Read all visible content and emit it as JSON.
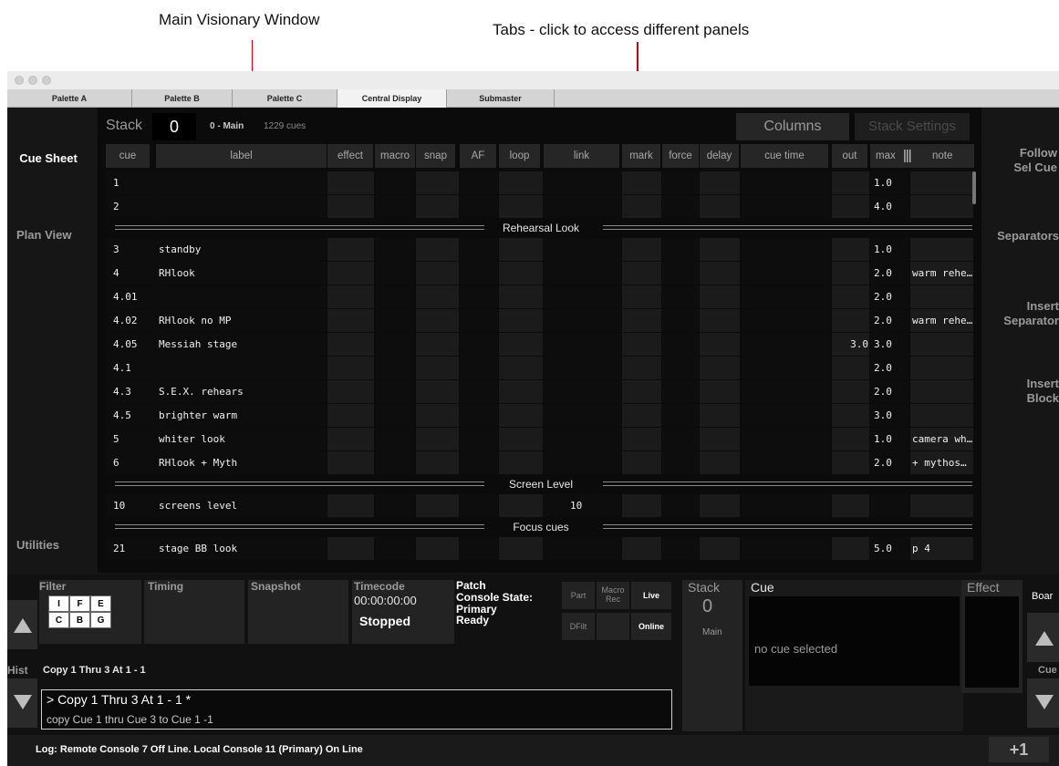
{
  "annotations": {
    "main_window": "Main Visionary Window",
    "tabs": "Tabs - click to access different panels"
  },
  "tabs": [
    "Palette A",
    "Palette B",
    "Palette C",
    "Central Display",
    "Submaster"
  ],
  "active_tab": "Central Display",
  "stack_bar": {
    "stack_label": "Stack",
    "stack_value": "0",
    "stack_name": "0 - Main",
    "cue_count": "1229 cues",
    "columns_button": "Columns",
    "stack_settings_button": "Stack Settings"
  },
  "left_nav": {
    "cue_sheet": "Cue Sheet",
    "plan_view": "Plan View",
    "utilities": "Utilities"
  },
  "right_nav": {
    "follow_line1": "Follow",
    "follow_line2": "Sel Cue",
    "separators": "Separators",
    "insert_sep_line1": "Insert",
    "insert_sep_line2": "Separator",
    "insert_block_line1": "Insert",
    "insert_block_line2": "Block"
  },
  "columns": [
    "cue",
    "label",
    "effect",
    "macro",
    "snap",
    "AF",
    "loop",
    "link",
    "mark",
    "force",
    "delay",
    "cue time",
    "out",
    "max",
    "|||",
    "note"
  ],
  "rows": [
    {
      "type": "cue",
      "cue": "1",
      "label": "",
      "link": "",
      "out": "",
      "max": "1.0",
      "note": ""
    },
    {
      "type": "cue",
      "cue": "2",
      "label": "",
      "link": "",
      "out": "",
      "max": "4.0",
      "note": ""
    },
    {
      "type": "sep",
      "title": "Rehearsal Look"
    },
    {
      "type": "cue",
      "cue": "3",
      "label": "standby",
      "link": "",
      "out": "",
      "max": "1.0",
      "note": ""
    },
    {
      "type": "cue",
      "cue": "4",
      "label": "RHlook",
      "link": "",
      "out": "",
      "max": "2.0",
      "note": "warm rehe…"
    },
    {
      "type": "cue",
      "cue": "4.01",
      "label": "",
      "link": "",
      "out": "",
      "max": "2.0",
      "note": ""
    },
    {
      "type": "cue",
      "cue": "4.02",
      "label": "RHlook no MP",
      "link": "",
      "out": "",
      "max": "2.0",
      "note": "warm rehe…"
    },
    {
      "type": "cue",
      "cue": "4.05",
      "label": "Messiah stage",
      "link": "",
      "out": "3.0",
      "max": "3.0",
      "note": ""
    },
    {
      "type": "cue",
      "cue": "4.1",
      "label": "",
      "link": "",
      "out": "",
      "max": "2.0",
      "note": ""
    },
    {
      "type": "cue",
      "cue": "4.3",
      "label": "S.E.X. rehears",
      "link": "",
      "out": "",
      "max": "2.0",
      "note": ""
    },
    {
      "type": "cue",
      "cue": "4.5",
      "label": "brighter warm",
      "link": "",
      "out": "",
      "max": "3.0",
      "note": ""
    },
    {
      "type": "cue",
      "cue": "5",
      "label": "whiter look",
      "link": "",
      "out": "",
      "max": "1.0",
      "note": "camera wh…"
    },
    {
      "type": "cue",
      "cue": "6",
      "label": "RHlook + Myth",
      "link": "",
      "out": "",
      "max": "2.0",
      "note": "+ mythos…"
    },
    {
      "type": "sep",
      "title": "Screen Level"
    },
    {
      "type": "cue",
      "cue": "10",
      "label": "screens level",
      "link": "10",
      "out": "",
      "max": "",
      "note": ""
    },
    {
      "type": "sep",
      "title": "Focus cues"
    },
    {
      "type": "cue",
      "cue": "21",
      "label": "stage BB look",
      "link": "",
      "out": "",
      "max": "5.0",
      "note": "p 4"
    }
  ],
  "bottom": {
    "filter_label": "Filter",
    "filter_grid": [
      "I",
      "F",
      "E",
      "C",
      "B",
      "G"
    ],
    "timing_label": "Timing",
    "snapshot_label": "Snapshot",
    "timecode_label": "Timecode",
    "timecode_value": "00:00:00:00",
    "timecode_status": "Stopped",
    "patch_label": "Patch",
    "console_state_label": "Console State:",
    "console_state_value1": "Primary",
    "console_state_value2": "Ready",
    "part_btn": "Part",
    "macro_rec_1": "Macro",
    "macro_rec_2": "Rec",
    "live_btn": "Live",
    "dfilt_btn": "DFilt",
    "online_btn": "Online",
    "hist_label": "Hist",
    "history_line": "Copy 1 Thru 3 At 1 - 1",
    "command_line": "> Copy  1 Thru  3 At  1 -  1 *",
    "command_desc": "copy Cue 1 thru Cue 3 to Cue 1 -1",
    "stack_label": "Stack",
    "stack_value": "0",
    "stack_name": "Main",
    "cue_label": "Cue",
    "effect_label": "Effect",
    "no_cue": "no cue selected",
    "board_label": "Boar",
    "cue_nav_label": "Cue",
    "plus_one": "+1",
    "log_text": "Log: Remote Console 7 Off Line.  Local Console 11 (Primary) On Line"
  },
  "colors": {
    "arrow": "#d0021b",
    "background": "#161616"
  }
}
